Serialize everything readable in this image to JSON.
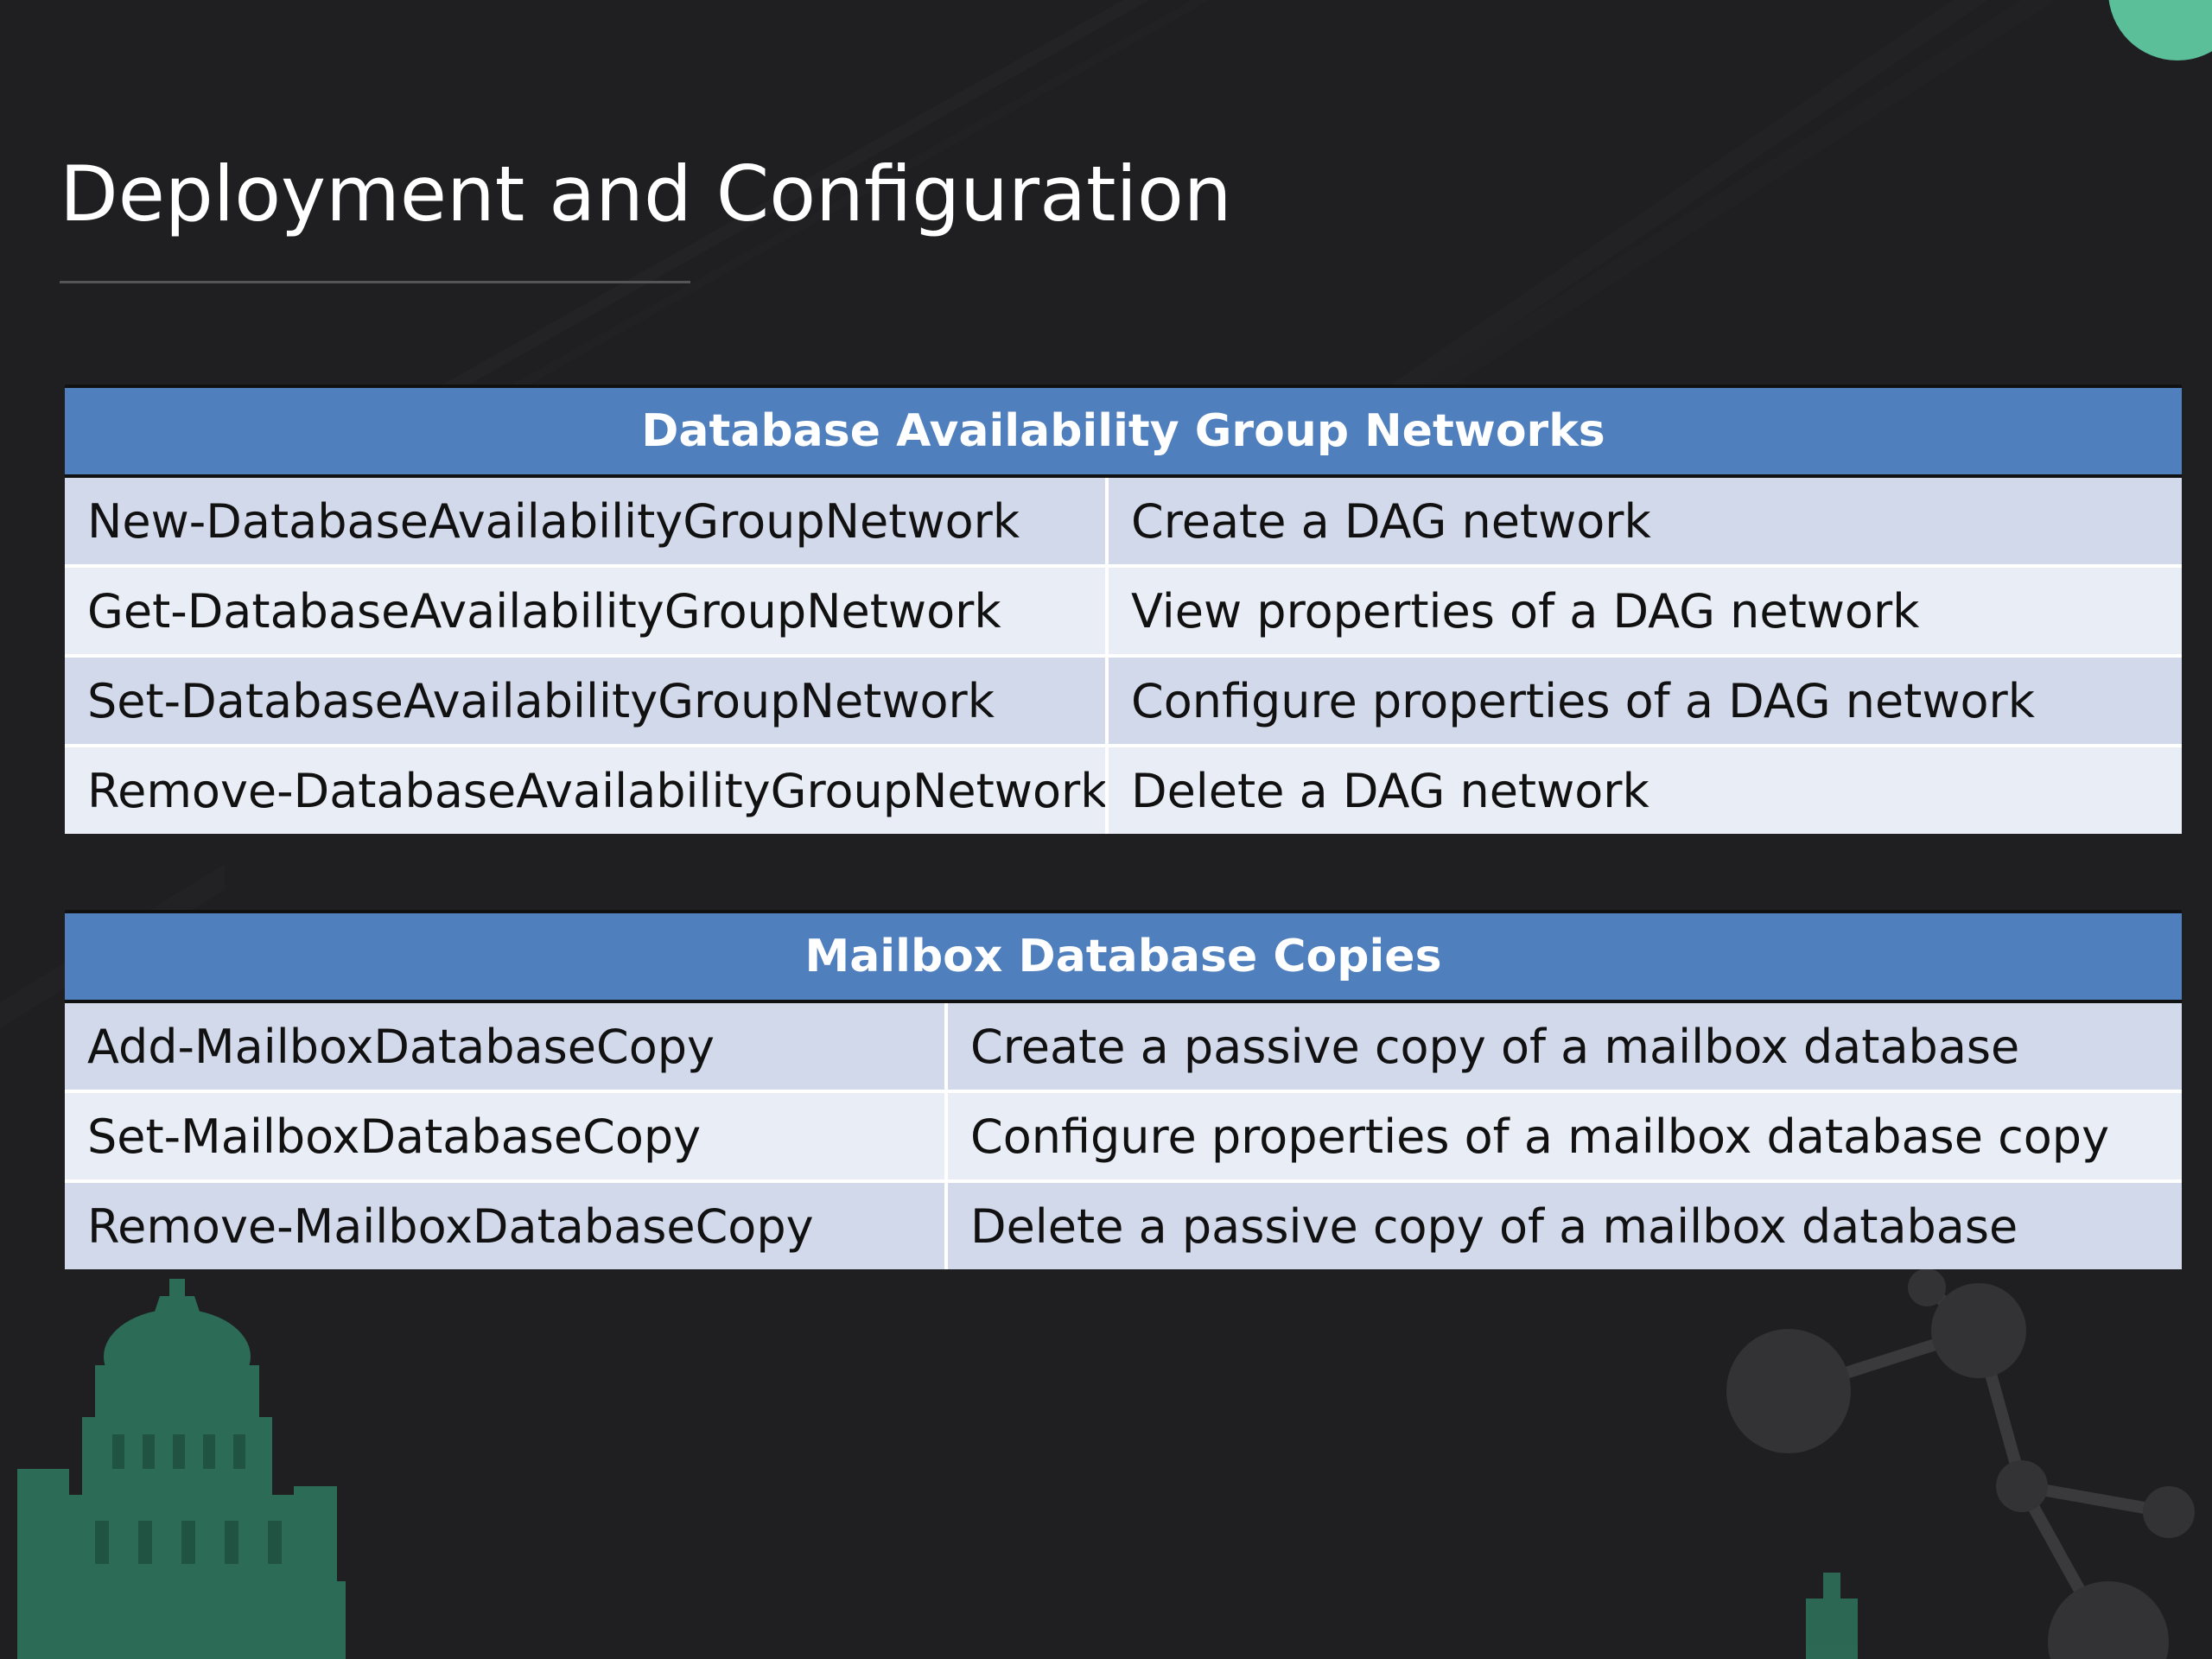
{
  "slide": {
    "title": "Deployment and Configuration"
  },
  "tables": [
    {
      "header": "Database Availability Group Networks",
      "rows": [
        {
          "cmdlet": "New-DatabaseAvailabilityGroupNetwork",
          "description": "Create a DAG network"
        },
        {
          "cmdlet": "Get-DatabaseAvailabilityGroupNetwork",
          "description": "View properties of a DAG network"
        },
        {
          "cmdlet": "Set-DatabaseAvailabilityGroupNetwork",
          "description": "Configure properties of a DAG network"
        },
        {
          "cmdlet": "Remove-DatabaseAvailabilityGroupNetwork",
          "description": "Delete a DAG network"
        }
      ]
    },
    {
      "header": "Mailbox Database Copies",
      "rows": [
        {
          "cmdlet": "Add-MailboxDatabaseCopy",
          "description": "Create a passive copy of a mailbox database"
        },
        {
          "cmdlet": "Set-MailboxDatabaseCopy",
          "description": "Configure properties of a mailbox database copy"
        },
        {
          "cmdlet": "Remove-MailboxDatabaseCopy",
          "description": "Delete a passive copy of a mailbox database"
        }
      ]
    }
  ],
  "colors": {
    "background": "#1f1f21",
    "header_fill": "#4f7fbd",
    "row_odd": "#d2d9ea",
    "row_even": "#e9edf5",
    "accent_green": "#3f9a7a"
  },
  "decor": [
    "building-silhouette",
    "molecule-graphic",
    "green-circle",
    "diagonal-stripes"
  ]
}
